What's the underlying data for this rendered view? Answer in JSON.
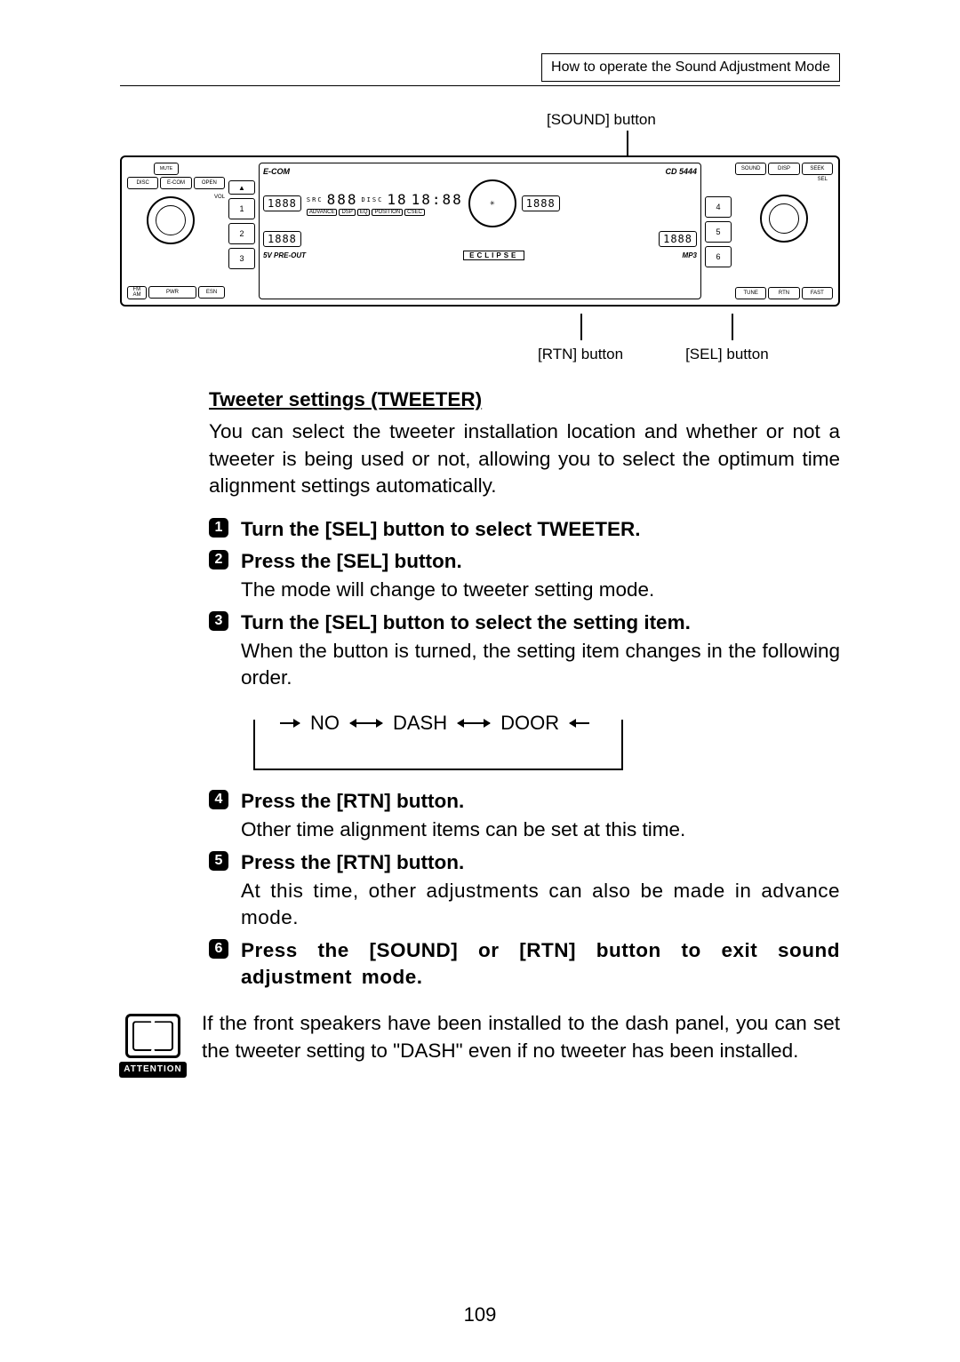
{
  "header": {
    "breadcrumb": "How to operate the Sound Adjustment Mode"
  },
  "callouts": {
    "sound": "[SOUND] button",
    "rtn": "[RTN] button",
    "sel": "[SEL] button"
  },
  "device": {
    "top_buttons": [
      "MUTE"
    ],
    "left_top": [
      "DISC",
      "E-COM",
      "OPEN"
    ],
    "vol_label": "VOL",
    "eject": "▲",
    "presets_left": [
      "1",
      "2",
      "3"
    ],
    "esn": "ESN",
    "fm_am": "FM\nAM",
    "pwr": "PWR",
    "preout": "5V PRE-OUT",
    "ecom_brand": "E-COM",
    "model": "CD 5444",
    "lcd_src": "SRC",
    "lcd_disc": "DISC",
    "segA": "1888",
    "segB": "888",
    "segC": "18",
    "segD": "18:88",
    "segSide": "1888",
    "tags": [
      "ADVANCE",
      "DSP",
      "EQ",
      "POSITION",
      "CSEC"
    ],
    "brand": "ECLIPSE",
    "mp3": "MP3",
    "presets_right": [
      "4",
      "5",
      "6"
    ],
    "right_top": [
      "SOUND",
      "DISP",
      "SEEK"
    ],
    "sel_label": "SEL",
    "tune": "TUNE",
    "rtn_label": "RTN",
    "fast": "FAST"
  },
  "section": {
    "title": "Tweeter settings (TWEETER)",
    "intro": "You can select the tweeter installation location and whether or not a tweeter is being used or not, allowing you to select the optimum time alignment settings automatically."
  },
  "steps": [
    {
      "n": "1",
      "head": "Turn the [SEL] button to select TWEETER.",
      "body": ""
    },
    {
      "n": "2",
      "head": "Press the [SEL] button.",
      "body": "The mode will change to tweeter setting mode."
    },
    {
      "n": "3",
      "head": "Turn the [SEL] button to select the setting item.",
      "body": "When the button is turned, the setting item changes in the following order."
    },
    {
      "n": "4",
      "head": "Press the [RTN] button.",
      "body": "Other time alignment items can be set at this time."
    },
    {
      "n": "5",
      "head": "Press the [RTN] button.",
      "body": "At this time, other adjustments can also be made in advance mode."
    },
    {
      "n": "6",
      "head": "Press the [SOUND] or [RTN] button to exit sound adjustment mode.",
      "body": ""
    }
  ],
  "cycle": {
    "a": "NO",
    "b": "DASH",
    "c": "DOOR"
  },
  "attention": {
    "label": "ATTENTION",
    "text": "If the front speakers have been installed to the dash panel, you can set the tweeter setting to \"DASH\" even if no tweeter has been installed."
  },
  "page_number": "109"
}
